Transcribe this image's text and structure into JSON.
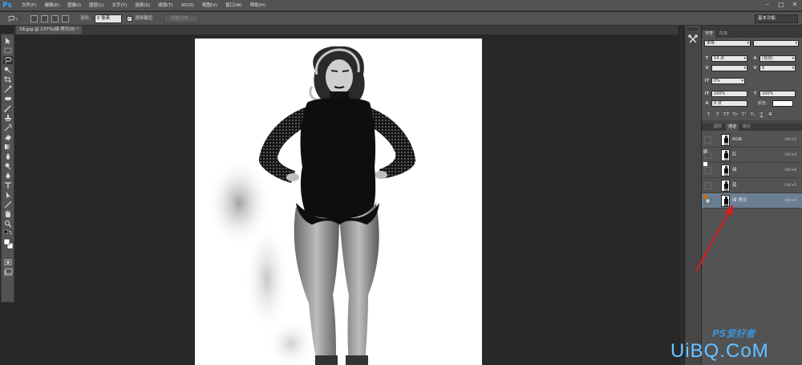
{
  "app": {
    "logo": "Ps"
  },
  "menu": [
    "文件(F)",
    "编辑(E)",
    "图像(I)",
    "图层(L)",
    "文字(Y)",
    "选择(S)",
    "滤镜(T)",
    "3D(D)",
    "视图(V)",
    "窗口(W)",
    "帮助(H)"
  ],
  "window_controls": [
    "–",
    "□",
    "✕"
  ],
  "options_bar": {
    "feather_label": "羽化:",
    "feather_value": "0 像素",
    "antialias_checked": true,
    "antialias_label": "消除锯齿",
    "refine_edge": "调整边缘...",
    "workspace": "基本功能"
  },
  "document": {
    "tab_title": "18.jpg @ 137%(绿 拷贝/8) *"
  },
  "character_panel": {
    "tabs": [
      "字符",
      "段落"
    ],
    "font_family": "宋体",
    "font_style": "-",
    "font_size": "14 点",
    "leading": "(自动)",
    "kerning": "",
    "tracking": "0",
    "vscale_icon": "IT",
    "vscale_pct": "0%",
    "vertical_scale": "100%",
    "horizontal_scale": "100%",
    "baseline_shift": "0 点",
    "color_label": "颜色:",
    "type_styles": [
      "T",
      "T",
      "TT",
      "Tr",
      "T¹",
      "T₁",
      "T",
      "T"
    ],
    "swatch_color": "#ffffff"
  },
  "channels_panel": {
    "tabs": [
      "图层",
      "通道",
      "路径"
    ],
    "active_tab": "通道",
    "channels": [
      {
        "name": "RGB",
        "shortcut": "Ctrl+2",
        "visible": false,
        "selected": false
      },
      {
        "name": "红",
        "shortcut": "Ctrl+3",
        "visible": false,
        "selected": false
      },
      {
        "name": "绿",
        "shortcut": "Ctrl+4",
        "visible": false,
        "selected": false
      },
      {
        "name": "蓝",
        "shortcut": "Ctrl+5",
        "visible": false,
        "selected": false
      },
      {
        "name": "绿 拷贝",
        "shortcut": "Ctrl+6",
        "visible": true,
        "selected": true
      }
    ]
  },
  "watermark": {
    "top": "PS爱好者",
    "main": "UiBQ.CoM"
  },
  "colors": {
    "selected_row": "#6b7e94",
    "arrow": "#d42020",
    "watermark": "#6cc2ff"
  }
}
